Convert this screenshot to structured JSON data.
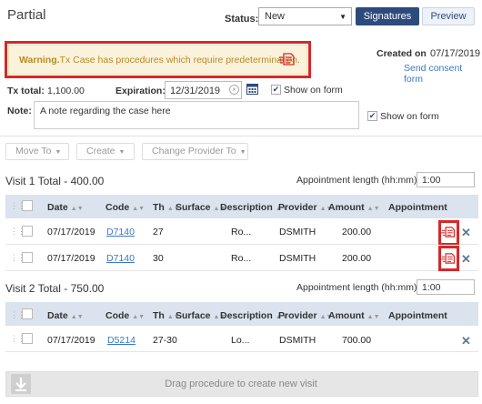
{
  "header": {
    "title": "Partial",
    "status_label": "Status:",
    "status_value": "New",
    "signatures_label": "Signatures",
    "preview_label": "Preview"
  },
  "warning": {
    "prefix": "Warning.",
    "message": "Tx Case has procedures which require predetermination.",
    "icon": "predetermination-icon"
  },
  "created": {
    "label": "Created on",
    "date": "07/17/2019",
    "consent_link": "Send consent form"
  },
  "txcase": {
    "total_label": "Tx total:",
    "total_value": "1,100.00",
    "expiration_label": "Expiration:",
    "expiration_value": "12/31/2019",
    "show_on_form_label": "Show on form",
    "note_label": "Note:",
    "note_value": "A note regarding the case here"
  },
  "toolbar": {
    "move_to": "Move To",
    "create": "Create",
    "change_provider": "Change Provider To"
  },
  "columns": [
    "Date",
    "Code",
    "Th",
    "Surface",
    "Description",
    "Provider",
    "Amount",
    "Appointment"
  ],
  "appointment_length_label": "Appointment length (hh:mm)",
  "visits": [
    {
      "title": "Visit 1 Total - 400.00",
      "length": "1:00",
      "rows": [
        {
          "date": "07/17/2019",
          "code": "D7140",
          "th": "27",
          "surface": "",
          "description": "Ro...",
          "provider": "DSMITH",
          "amount": "200.00"
        },
        {
          "date": "07/17/2019",
          "code": "D7140",
          "th": "30",
          "surface": "",
          "description": "Ro...",
          "provider": "DSMITH",
          "amount": "200.00"
        }
      ]
    },
    {
      "title": "Visit 2 Total - 750.00",
      "length": "1:00",
      "rows": [
        {
          "date": "07/17/2019",
          "code": "D5214",
          "th": "27-30",
          "surface": "",
          "description": "Lo...",
          "provider": "DSMITH",
          "amount": "700.00"
        }
      ]
    }
  ],
  "drag_text": "Drag procedure to create new visit",
  "colors": {
    "primary": "#2c4a7c",
    "warning_bg": "#fbf2dc",
    "warning_text": "#b88a20",
    "highlight": "#d62828",
    "link": "#3a78c9",
    "table_header": "#dbe3ee"
  }
}
